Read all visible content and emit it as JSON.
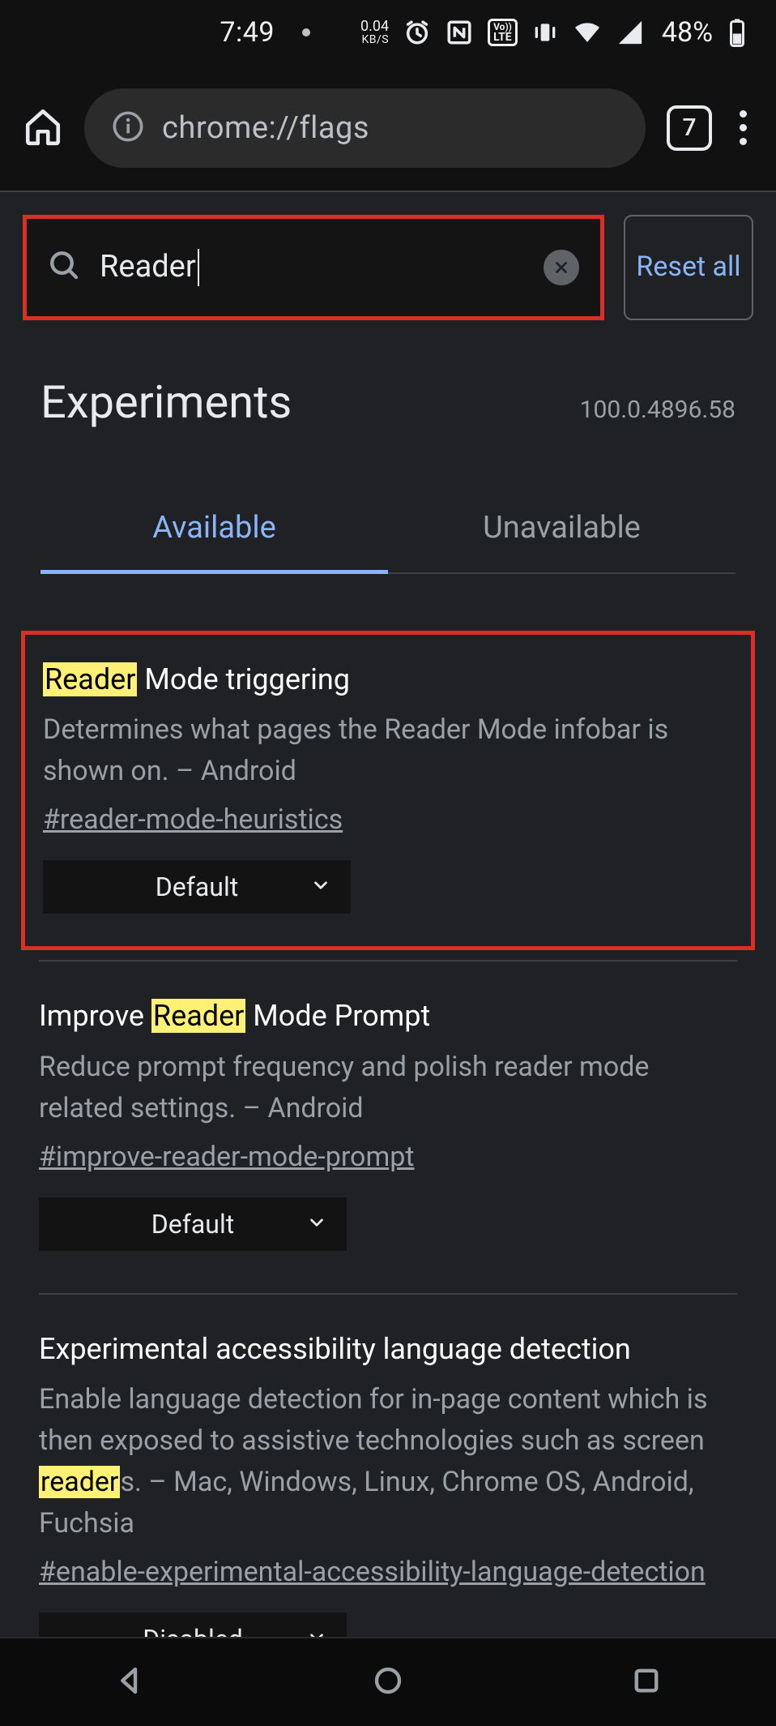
{
  "status": {
    "time": "7:49",
    "speed_value": "0.04",
    "speed_unit": "KB/S",
    "volte": "Vo LTE",
    "battery_pct": "48%"
  },
  "chrome": {
    "url": "chrome://flags",
    "tab_count": "7"
  },
  "search": {
    "value": "Reader",
    "reset_label": "Reset all"
  },
  "header": {
    "title": "Experiments",
    "version": "100.0.4896.58"
  },
  "tabs": {
    "available": "Available",
    "unavailable": "Unavailable"
  },
  "flags": [
    {
      "title_pre": "",
      "title_hl": "Reader",
      "title_post": " Mode triggering",
      "desc": "Determines what pages the Reader Mode infobar is shown on. – Android",
      "hash": "#reader-mode-heuristics",
      "select": "Default",
      "highlighted": true
    },
    {
      "title_pre": "Improve ",
      "title_hl": "Reader",
      "title_post": " Mode Prompt",
      "desc": "Reduce prompt frequency and polish reader mode related settings. – Android",
      "hash": "#improve-reader-mode-prompt",
      "select": "Default",
      "highlighted": false
    },
    {
      "title_pre": "Experimental accessibility language detection",
      "title_hl": "",
      "title_post": "",
      "desc_pre": "Enable language detection for in-page content which is then exposed to assistive technologies such as screen ",
      "desc_hl": "reader",
      "desc_post": "s. – Mac, Windows, Linux, Chrome OS, Android, Fuchsia",
      "hash": "#enable-experimental-accessibility-language-detection",
      "select": "Disabled",
      "highlighted": false
    }
  ]
}
